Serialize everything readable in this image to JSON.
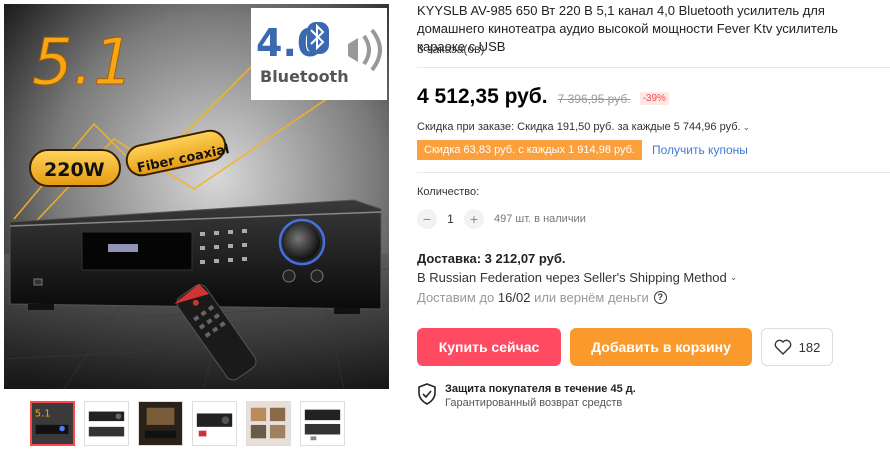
{
  "gallery": {
    "main_text_51": "5.1",
    "main_text_version": "4.0",
    "main_text_bluetooth": "Bluetooth",
    "main_text_power": "220W",
    "main_text_coaxial": "Fiber coaxial",
    "thumb_count": 6,
    "active_thumb": 0
  },
  "product": {
    "title": "KYYSLB AV-985 650 Вт 220 В 5,1 канал 4,0 Bluetooth усилитель для домашнего кинотеатра аудио высокой мощности Fever Ktv усилитель караоке с USB",
    "orders": "3 заказа(ов)"
  },
  "price": {
    "current": "4 512,35 руб.",
    "old": "7 396,95 руб.",
    "discount": "-39%"
  },
  "coupons": {
    "order_discount": "Скидка при заказе: Скидка 191,50 руб. за каждые 5 744,96 руб.",
    "coupon_tag": "Скидка 63,83 руб. с каждых 1 914,98 руб.",
    "get_coupons": "Получить купоны"
  },
  "quantity": {
    "label": "Количество:",
    "value": "1",
    "minus": "−",
    "plus": "+",
    "stock": "497 шт. в наличии"
  },
  "shipping": {
    "title": "Доставка: 3 212,07 руб.",
    "method": "В Russian Federation через Seller's Shipping Method",
    "date_prefix": "Доставим до",
    "date": "16/02",
    "date_suffix": "или вернём деньги"
  },
  "actions": {
    "buy_now": "Купить сейчас",
    "add_to_cart": "Добавить в корзину",
    "wishlist_count": "182"
  },
  "protection": {
    "title": "Защита покупателя в течение 45 д.",
    "subtitle": "Гарантированный возврат средств"
  },
  "colors": {
    "buy_button": "#ff4a61",
    "cart_button": "#fa9a2c",
    "coupon_tag": "#fca03d",
    "link": "#3b7bd6",
    "discount": "#ff4747"
  }
}
